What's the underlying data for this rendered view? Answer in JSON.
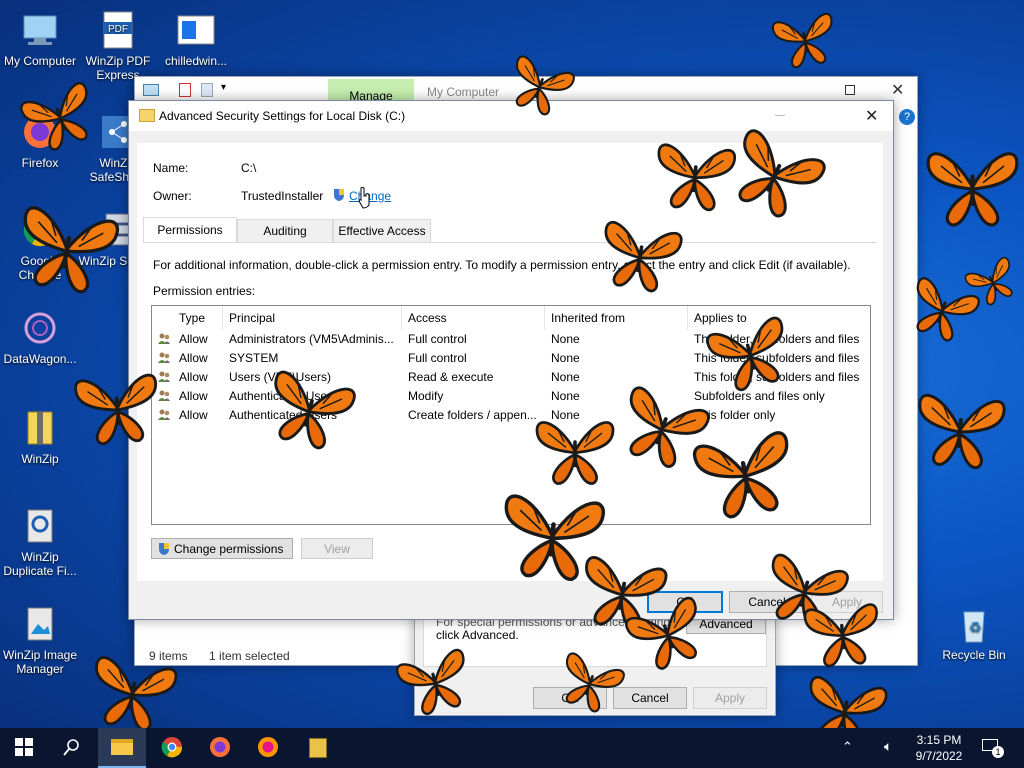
{
  "desktop": {
    "icons": [
      {
        "label": "My Computer"
      },
      {
        "label": "WinZip PDF Express"
      },
      {
        "label": "chilledwin..."
      },
      {
        "label": "Firefox"
      },
      {
        "label": "WinZip SafeShare"
      },
      {
        "label": "Google Chrome"
      },
      {
        "label": "WinZip Secure"
      },
      {
        "label": "DataWagon..."
      },
      {
        "label": "WinZip"
      },
      {
        "label": "WinZip Duplicate Fi..."
      },
      {
        "label": "WinZip Image Manager"
      },
      {
        "label": "Recycle Bin"
      }
    ]
  },
  "explorer": {
    "ribbon_tab": "Manage",
    "title": "My Computer",
    "status_items": "9 items",
    "status_selected": "1 item selected"
  },
  "properties": {
    "hint_line1": "For special permissions or advanced settings,",
    "hint_line2": "click Advanced.",
    "advanced_btn": "Advanced",
    "ok": "OK",
    "cancel": "Cancel",
    "apply": "Apply"
  },
  "dialog": {
    "title": "Advanced Security Settings for Local Disk (C:)",
    "name_label": "Name:",
    "name_value": "C:\\",
    "owner_label": "Owner:",
    "owner_value": "TrustedInstaller",
    "change_link": "Change",
    "tabs": [
      "Permissions",
      "Auditing",
      "Effective Access"
    ],
    "info_text": "For additional information, double-click a permission entry. To modify a permission entry, select the entry and click Edit (if available).",
    "entries_label": "Permission entries:",
    "columns": [
      "Type",
      "Principal",
      "Access",
      "Inherited from",
      "Applies to"
    ],
    "rows": [
      {
        "type": "Allow",
        "principal": "Administrators (VM5\\Adminis...",
        "access": "Full control",
        "inherited": "None",
        "applies": "This folder, subfolders and files"
      },
      {
        "type": "Allow",
        "principal": "SYSTEM",
        "access": "Full control",
        "inherited": "None",
        "applies": "This folder, subfolders and files"
      },
      {
        "type": "Allow",
        "principal": "Users (VM5\\Users)",
        "access": "Read & execute",
        "inherited": "None",
        "applies": "This folder, subfolders and files"
      },
      {
        "type": "Allow",
        "principal": "Authenticated Users",
        "access": "Modify",
        "inherited": "None",
        "applies": "Subfolders and files only"
      },
      {
        "type": "Allow",
        "principal": "Authenticated Users",
        "access": "Create folders / appen...",
        "inherited": "None",
        "applies": "This folder only"
      }
    ],
    "change_permissions": "Change permissions",
    "view": "View",
    "ok": "OK",
    "cancel": "Cancel",
    "apply": "Apply"
  },
  "taskbar": {
    "time": "3:15 PM",
    "date": "9/7/2022",
    "notification_count": "1"
  },
  "colors": {
    "accent": "#0078d7",
    "manage_tab": "#c6efb0",
    "butterfly": "#f07a10"
  }
}
